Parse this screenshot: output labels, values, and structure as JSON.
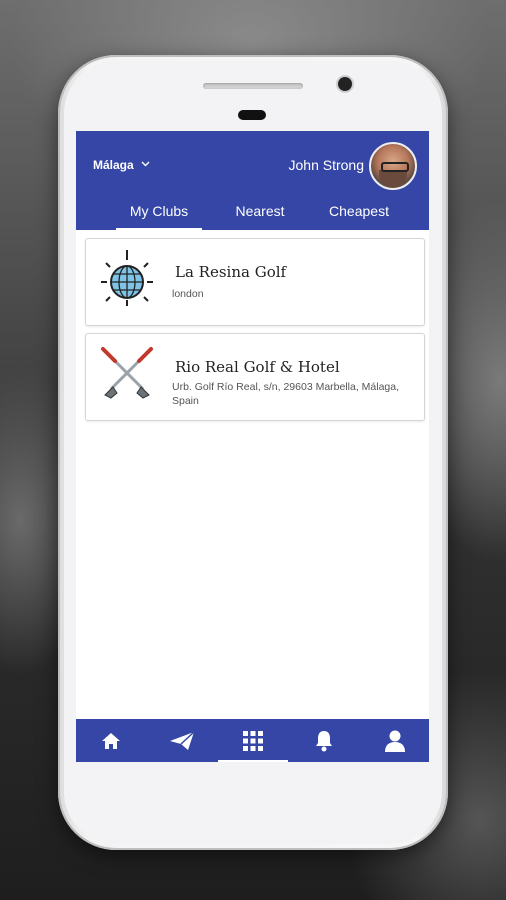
{
  "header": {
    "city": "Málaga",
    "user_name": "John Strong"
  },
  "tabs": [
    {
      "label": "My Clubs",
      "active": true
    },
    {
      "label": "Nearest",
      "active": false
    },
    {
      "label": "Cheapest",
      "active": false
    }
  ],
  "clubs": [
    {
      "name": "La Resina Golf",
      "address": "london",
      "icon": "disco-globe-icon"
    },
    {
      "name": "Rio Real Golf & Hotel",
      "address": "Urb. Golf Río Real, s/n, 29603 Marbella, Málaga, Spain",
      "icon": "crossed-golf-clubs-icon"
    }
  ],
  "bottom_nav": [
    {
      "icon": "home-icon"
    },
    {
      "icon": "send-icon"
    },
    {
      "icon": "grid-icon",
      "active": true
    },
    {
      "icon": "bell-icon"
    },
    {
      "icon": "user-icon"
    }
  ],
  "colors": {
    "primary": "#3546a6",
    "card_border": "#d5d5d5"
  }
}
